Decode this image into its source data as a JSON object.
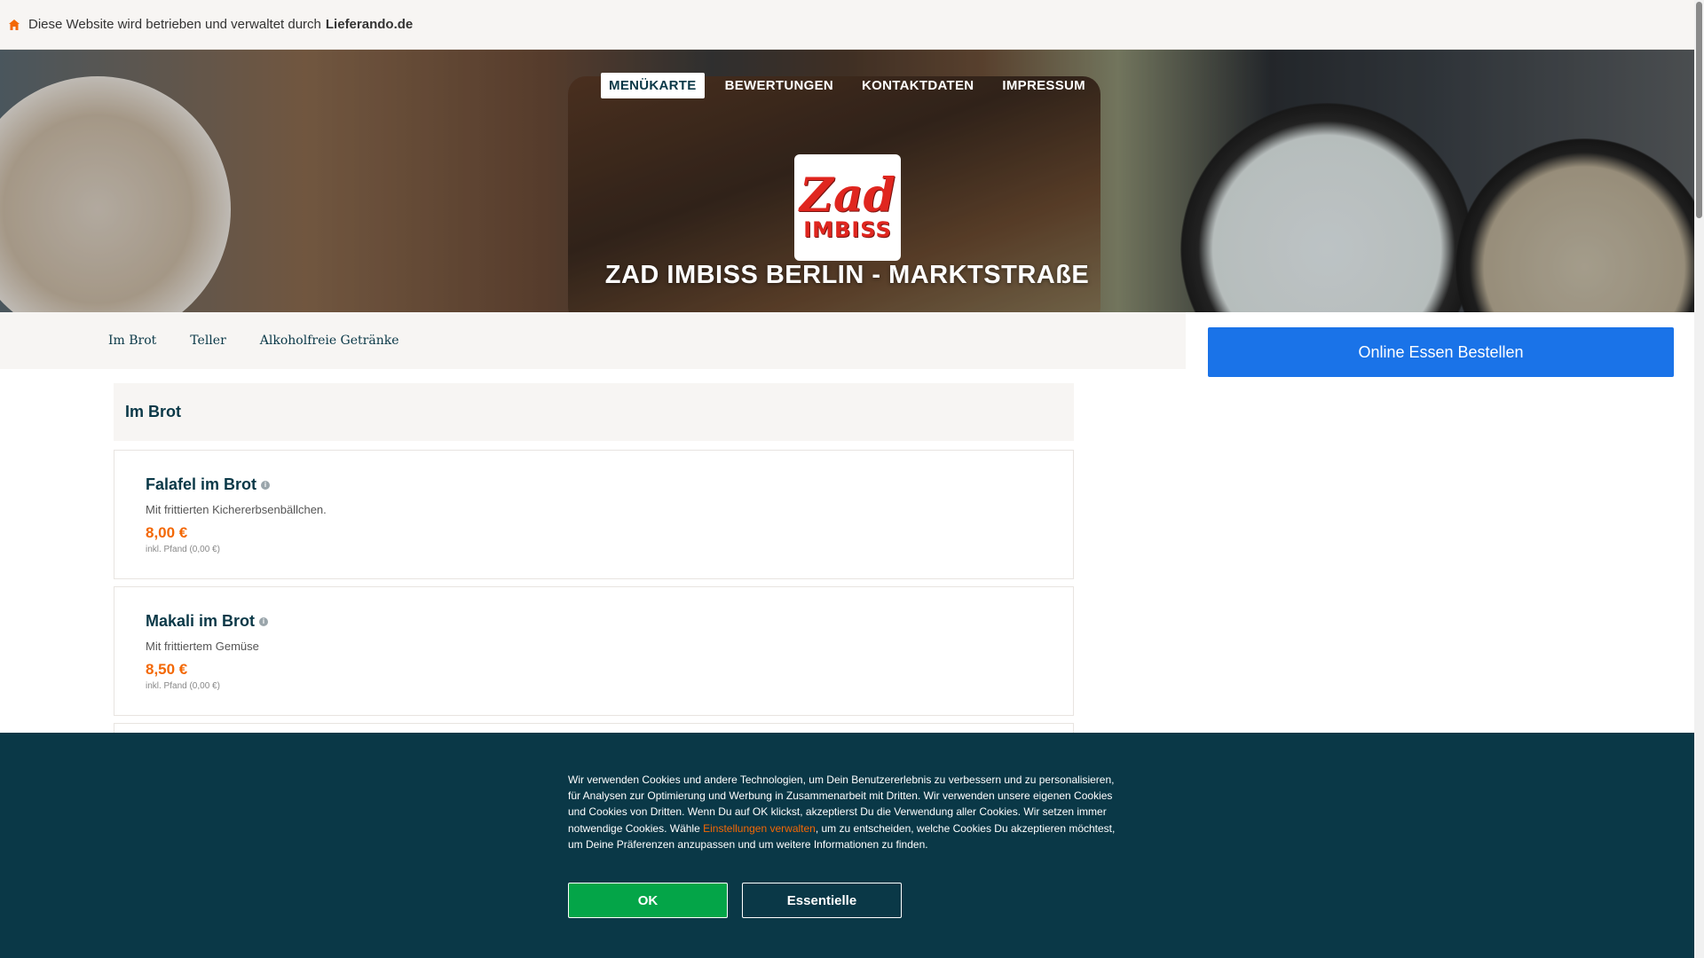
{
  "topbar": {
    "text": "Diese Website wird betrieben und verwaltet durch",
    "brand": "Lieferando.de",
    "icon": "home-icon"
  },
  "nav": {
    "items": [
      "MENÜKARTE",
      "BEWERTUNGEN",
      "KONTAKTDATEN",
      "IMPRESSUM"
    ],
    "active_index": 0
  },
  "logo": {
    "line1": "Zad",
    "line2": "IMBISS"
  },
  "restaurant": {
    "name": "ZAD IMBISS BERLIN - MARKTSTRAßE"
  },
  "categories": [
    "Im Brot",
    "Teller",
    "Alkoholfreie Getränke"
  ],
  "order_button": "Online Essen Bestellen",
  "section": {
    "title": "Im Brot"
  },
  "items": [
    {
      "name": "Falafel im Brot",
      "desc": "Mit frittierten Kichererbsenbällchen.",
      "price": "8,00 €",
      "deposit": "inkl. Pfand (0,00 €)"
    },
    {
      "name": "Makali im Brot",
      "desc": "Mit frittiertem Gemüse",
      "price": "8,50 €",
      "deposit": "inkl. Pfand (0,00 €)"
    }
  ],
  "cookie": {
    "text_before": "Wir verwenden Cookies und andere Technologien, um Dein Benutzererlebnis zu verbessern und zu personalisieren, für Analysen zur Optimierung und Werbung in Zusammenarbeit mit Dritten. Wir verwenden unsere eigenen Cookies und Cookies von Dritten. Wenn Du auf OK klickst, akzeptierst Du die Verwendung aller Cookies. Wir setzen immer notwendige Cookies. Wähle ",
    "link": "Einstellungen verwalten",
    "text_after": ", um zu entscheiden, welche Cookies Du akzeptieren möchtest, um Deine Präferenzen anzupassen und um weitere Informationen zu finden.",
    "ok_label": "OK",
    "essential_label": "Essentielle"
  },
  "colors": {
    "brand_dark": "#0a3847",
    "accent_orange": "#f36805",
    "order_blue": "#1a73e8",
    "ok_green": "#04a548"
  }
}
